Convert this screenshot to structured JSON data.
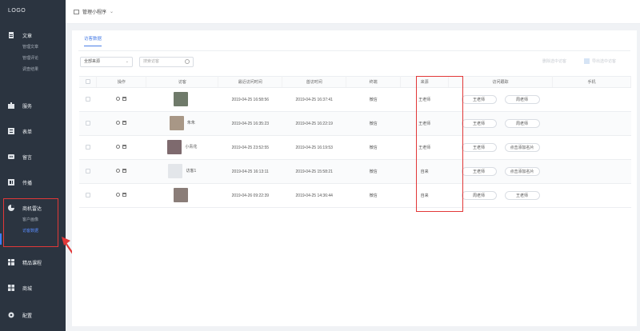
{
  "sidebar": {
    "logo": "LOGO",
    "groups": [
      {
        "label": "文章",
        "icon": "document-icon",
        "subs": [
          "管理文章",
          "管理评论",
          "调查结果"
        ]
      },
      {
        "label": "服务",
        "icon": "briefcase-icon",
        "subs": []
      },
      {
        "label": "表单",
        "icon": "form-icon",
        "subs": []
      },
      {
        "label": "留言",
        "icon": "message-icon",
        "subs": []
      },
      {
        "label": "传播",
        "icon": "share-icon",
        "subs": []
      },
      {
        "label": "商机雷达",
        "icon": "radar-icon",
        "subs": [
          "客户画像",
          "访客数据"
        ]
      },
      {
        "label": "精品课程",
        "icon": "course-icon",
        "subs": []
      },
      {
        "label": "商城",
        "icon": "grid-icon",
        "subs": []
      },
      {
        "label": "配置",
        "icon": "gear-icon",
        "subs": []
      }
    ]
  },
  "header": {
    "breadcrumb": "管理小程序"
  },
  "tabs": {
    "active": "访客数据"
  },
  "filters": {
    "source_select": "全部来源",
    "search_placeholder": "搜索访客",
    "btn1": "删除选中访客",
    "btn2": "导出选中访客"
  },
  "table": {
    "columns": [
      "操作",
      "访客",
      "最近访问时间",
      "首访时间",
      "终端",
      "来源",
      "访问跟踪",
      "手机"
    ],
    "rows": [
      {
        "name": "",
        "last_visit": "2019-04-25 16:58:56",
        "first_visit": "2019-04-25 16:37:41",
        "terminal": "微信",
        "source": "王老师",
        "track1": "王老师",
        "track2": "周老师",
        "phone": ""
      },
      {
        "name": "朱朱",
        "last_visit": "2019-04-25 16:35:23",
        "first_visit": "2019-04-25 16:22:19",
        "terminal": "微信",
        "source": "王老师",
        "track1": "王老师",
        "track2": "周老师",
        "phone": ""
      },
      {
        "name": "小青花",
        "last_visit": "2019-04-25 23:52:55",
        "first_visit": "2019-04-25 16:19:53",
        "terminal": "微信",
        "source": "王老师",
        "track1": "王老师",
        "track2": "点击添加名片",
        "phone": ""
      },
      {
        "name": "访客1",
        "last_visit": "2019-04-25 16:13:11",
        "first_visit": "2019-04-25 15:58:21",
        "terminal": "微信",
        "source": "自来",
        "track1": "王老师",
        "track2": "点击添加名片",
        "phone": ""
      },
      {
        "name": "",
        "last_visit": "2019-04-26 09:22:39",
        "first_visit": "2019-04-25 14:36:44",
        "terminal": "微信",
        "source": "自来",
        "track1": "周老师",
        "track2": "王老师",
        "phone": ""
      }
    ]
  },
  "colors": {
    "sidebar_bg": "#2b3440",
    "accent": "#3d7fff",
    "highlight": "#e23838"
  }
}
